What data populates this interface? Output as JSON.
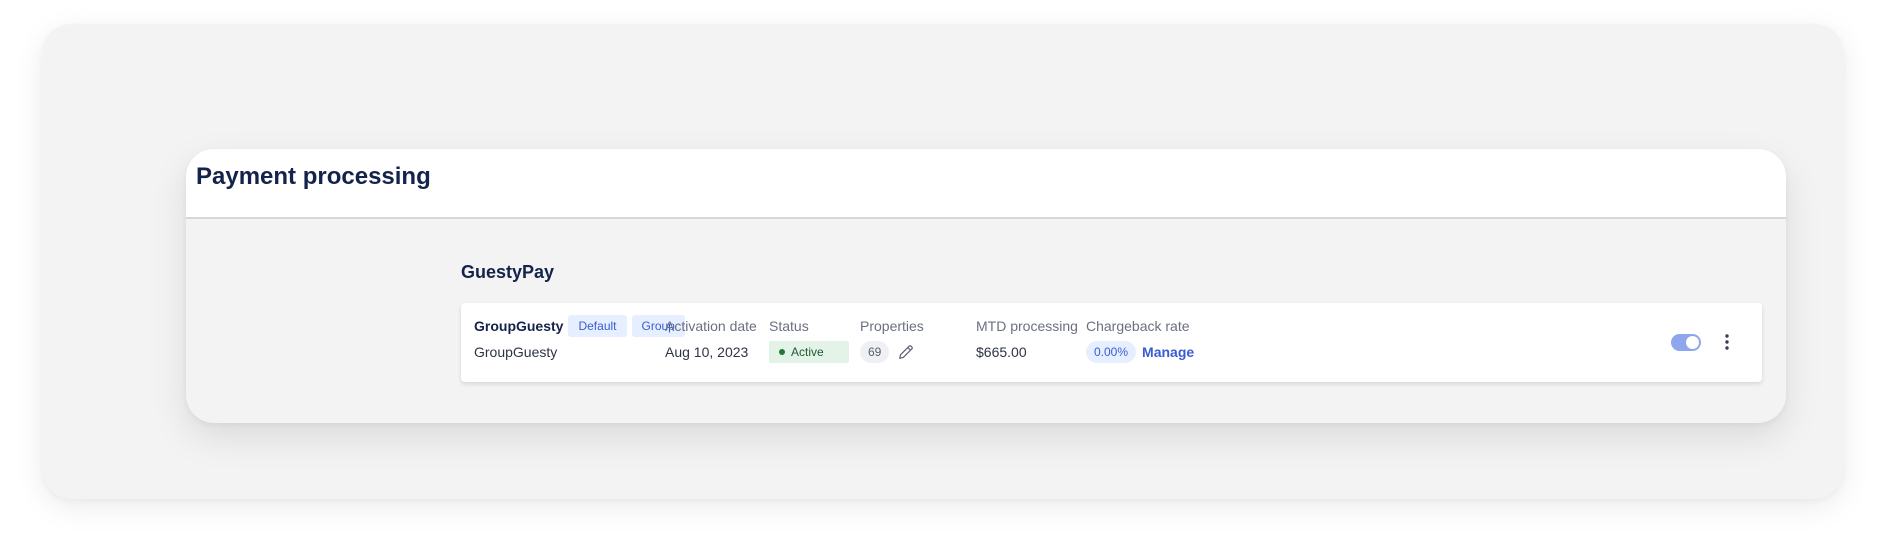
{
  "page": {
    "title": "Payment processing"
  },
  "section": {
    "title": "GuestyPay"
  },
  "provider": {
    "name": "GroupGuesty",
    "tags": [
      "Default",
      "Group"
    ],
    "subtitle": "GroupGuesty",
    "activation": {
      "label": "Activation date",
      "value": "Aug 10, 2023"
    },
    "status": {
      "label": "Status",
      "value": "Active",
      "color": "#1e7a3a"
    },
    "properties": {
      "label": "Properties",
      "count": "69"
    },
    "mtd": {
      "label": "MTD processing",
      "value": "$665.00"
    },
    "chargeback": {
      "label": "Chargeback rate",
      "rate": "0.00%",
      "action": "Manage"
    },
    "toggle": {
      "enabled": true,
      "color": "#8da6ee"
    },
    "icons": {
      "edit": "pencil-icon",
      "more": "more-vertical-icon"
    }
  },
  "colors": {
    "accent": "#3a5bd1",
    "title": "#14234b"
  }
}
